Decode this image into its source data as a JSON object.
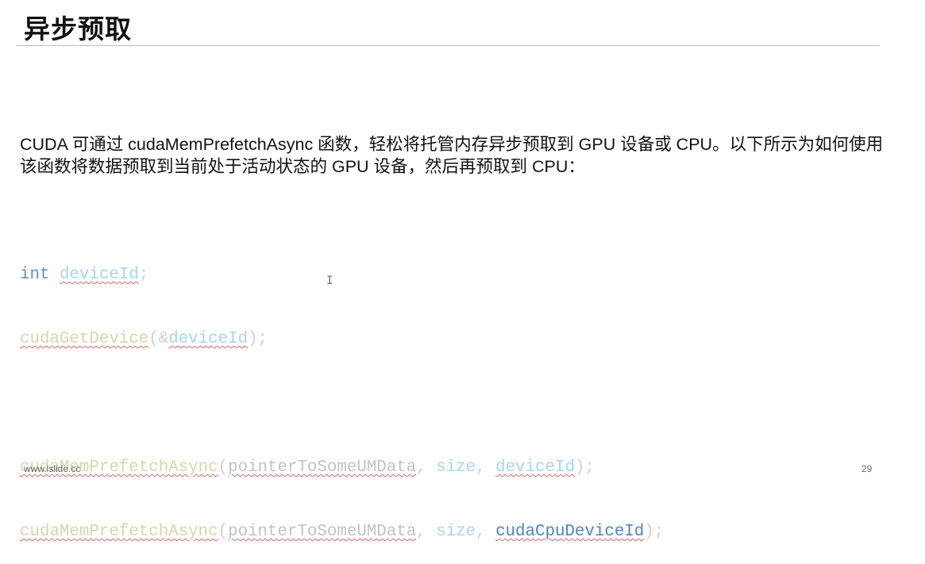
{
  "slide": {
    "title": "异步预取",
    "paragraph": "CUDA 可通过 cudaMemPrefetchAsync 函数，轻松将托管内存异步预取到 GPU 设备或 CPU。以下所示为如何使用该函数将数据预取到当前处于活动状态的 GPU 设备，然后再预取到 CPU：",
    "code": {
      "l1": {
        "kw": "int",
        "var": "deviceId",
        "end": ";"
      },
      "l2": {
        "fn": "cudaGetDevice",
        "open": "(&",
        "var": "deviceId",
        "end": ");"
      },
      "l3": {
        "fn": "cudaMemPrefetchAsync",
        "open": "(",
        "arg": "pointerToSomeUMData",
        "sep1": ", ",
        "size": "size",
        "sep2": ", ",
        "dev": "deviceId",
        "end": ");"
      },
      "l4": {
        "fn": "cudaMemPrefetchAsync",
        "open": "(",
        "arg": "pointerToSomeUMData",
        "sep1": ", ",
        "size": "size",
        "sep2": ", ",
        "dev": "cudaCpuDeviceId",
        "end": ");"
      }
    },
    "cursor": "I",
    "footer_site": "www.islide.cc",
    "page_number": "29"
  }
}
